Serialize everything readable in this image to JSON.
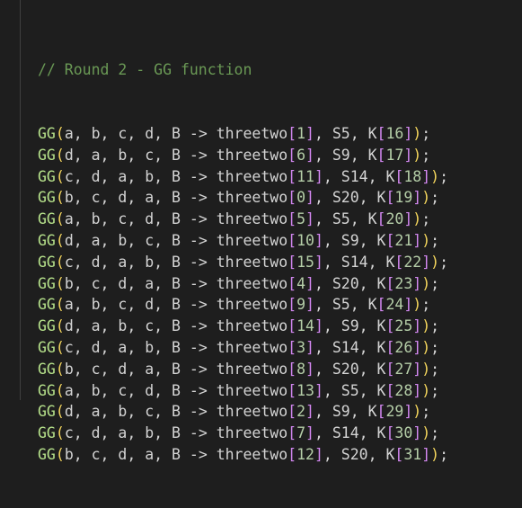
{
  "comment": "// Round 2 - GG function",
  "lines": [
    {
      "fn": "GG",
      "args": "a, b, c, d, B -> threetwo",
      "idx": "1",
      "mid": ", S5, K",
      "k": "16"
    },
    {
      "fn": "GG",
      "args": "d, a, b, c, B -> threetwo",
      "idx": "6",
      "mid": ", S9, K",
      "k": "17"
    },
    {
      "fn": "GG",
      "args": "c, d, a, b, B -> threetwo",
      "idx": "11",
      "mid": ", S14, K",
      "k": "18"
    },
    {
      "fn": "GG",
      "args": "b, c, d, a, B -> threetwo",
      "idx": "0",
      "mid": ", S20, K",
      "k": "19"
    },
    {
      "fn": "GG",
      "args": "a, b, c, d, B -> threetwo",
      "idx": "5",
      "mid": ", S5, K",
      "k": "20"
    },
    {
      "fn": "GG",
      "args": "d, a, b, c, B -> threetwo",
      "idx": "10",
      "mid": ", S9, K",
      "k": "21"
    },
    {
      "fn": "GG",
      "args": "c, d, a, b, B -> threetwo",
      "idx": "15",
      "mid": ", S14, K",
      "k": "22"
    },
    {
      "fn": "GG",
      "args": "b, c, d, a, B -> threetwo",
      "idx": "4",
      "mid": ", S20, K",
      "k": "23"
    },
    {
      "fn": "GG",
      "args": "a, b, c, d, B -> threetwo",
      "idx": "9",
      "mid": ", S5, K",
      "k": "24"
    },
    {
      "fn": "GG",
      "args": "d, a, b, c, B -> threetwo",
      "idx": "14",
      "mid": ", S9, K",
      "k": "25"
    },
    {
      "fn": "GG",
      "args": "c, d, a, b, B -> threetwo",
      "idx": "3",
      "mid": ", S14, K",
      "k": "26"
    },
    {
      "fn": "GG",
      "args": "b, c, d, a, B -> threetwo",
      "idx": "8",
      "mid": ", S20, K",
      "k": "27"
    },
    {
      "fn": "GG",
      "args": "a, b, c, d, B -> threetwo",
      "idx": "13",
      "mid": ", S5, K",
      "k": "28"
    },
    {
      "fn": "GG",
      "args": "d, a, b, c, B -> threetwo",
      "idx": "2",
      "mid": ", S9, K",
      "k": "29"
    },
    {
      "fn": "GG",
      "args": "c, d, a, b, B -> threetwo",
      "idx": "7",
      "mid": ", S14, K",
      "k": "30"
    },
    {
      "fn": "GG",
      "args": "b, c, d, a, B -> threetwo",
      "idx": "12",
      "mid": ", S20, K",
      "k": "31"
    }
  ]
}
